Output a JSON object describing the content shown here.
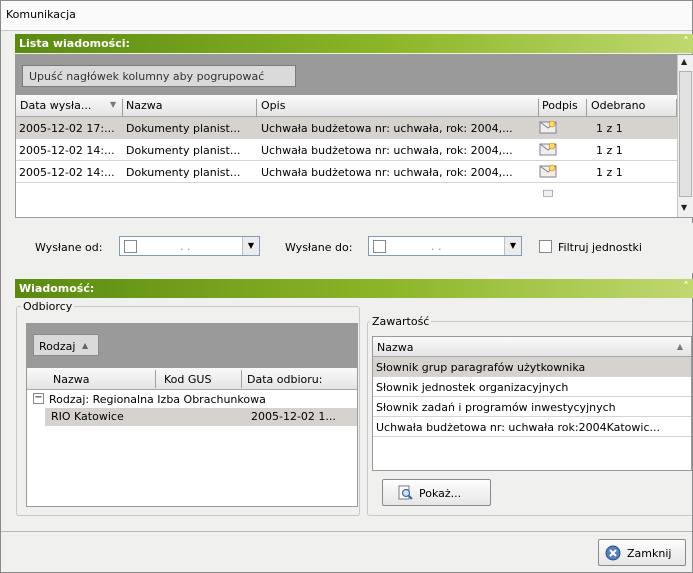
{
  "window": {
    "title": "Komunikacja"
  },
  "lista": {
    "header": "Lista wiadomości:",
    "collapse_glyph": "«",
    "group_hint": "Upuść nagłówek kolumny aby pogrupować",
    "columns": [
      "Data wysła...",
      "Nazwa",
      "Opis",
      "Podpis",
      "Odebrano"
    ],
    "rows": [
      {
        "data": "2005-12-02 17:...",
        "nazwa": "Dokumenty planist...",
        "opis": "Uchwała budżetowa nr: uchwała, rok: 2004,...",
        "odebrano": "1 z 1"
      },
      {
        "data": "2005-12-02 14:...",
        "nazwa": "Dokumenty planist...",
        "opis": "Uchwała budżetowa nr: uchwała, rok: 2004,...",
        "odebrano": "1 z 1"
      },
      {
        "data": "2005-12-02 14:...",
        "nazwa": "Dokumenty planist...",
        "opis": "Uchwała budżetowa nr: uchwała, rok: 2004,...",
        "odebrano": "1 z 1"
      }
    ]
  },
  "filters": {
    "wyslane_od_label": "Wysłane od:",
    "wyslane_od_value": ". .",
    "wyslane_do_label": "Wysłane do:",
    "wyslane_do_value": ". .",
    "filtruj_label": "Filtruj jednostki"
  },
  "wiadomosc": {
    "header": "Wiadomość:",
    "collapse_glyph": "«",
    "odbiorcy": {
      "legend": "Odbiorcy",
      "group_button": "Rodzaj",
      "columns": [
        "Nazwa",
        "Kod GUS",
        "Data odbioru:"
      ],
      "group_row": "Rodzaj: Regionalna Izba Obrachunkowa",
      "rows": [
        {
          "nazwa": "RIO Katowice",
          "kod": "",
          "data": "2005-12-02 1..."
        }
      ]
    },
    "zawartosc": {
      "legend": "Zawartość",
      "column": "Nazwa",
      "items": [
        "Słownik grup paragrafów użytkownika",
        "Słownik jednostek organizacyjnych",
        "Słownik zadań i programów inwestycyjnych",
        "Uchwała budżetowa nr: uchwała rok:2004Katowic..."
      ],
      "show_button": "Pokaż..."
    }
  },
  "footer": {
    "close_button": "Zamknij"
  },
  "colors": {
    "panel_header_dark": "#5a8a10",
    "panel_header_light": "#c0d870",
    "selected_row": "#d6d3cf"
  }
}
